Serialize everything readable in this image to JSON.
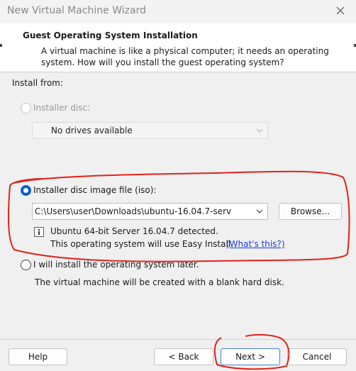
{
  "window": {
    "title": "New Virtual Machine Wizard"
  },
  "header": {
    "title": "Guest Operating System Installation",
    "description": "A virtual machine is like a physical computer; it needs an operating system. How will you install the guest operating system?"
  },
  "install": {
    "label": "Install from:",
    "disc": {
      "label": "Installer disc:",
      "selected": false,
      "enabled": false,
      "drive_value": "No drives available"
    },
    "iso": {
      "label": "Installer disc image file (iso):",
      "selected": true,
      "path_value": "C:\\Users\\user\\Downloads\\ubuntu-16.04.7-serv",
      "browse_label": "Browse...",
      "detected": "Ubuntu 64-bit Server 16.04.7 detected.",
      "easy_install": "This operating system will use Easy Install.",
      "whats_this": "(What's this?)"
    },
    "later": {
      "label": "I will install the operating system later.",
      "selected": false,
      "description": "The virtual machine will be created with a blank hard disk."
    }
  },
  "footer": {
    "help": "Help",
    "back": "< Back",
    "next": "Next >",
    "cancel": "Cancel"
  },
  "colors": {
    "accent": "#0a5fd1",
    "link": "#1d3fd6",
    "annotation": "#e2231a"
  }
}
